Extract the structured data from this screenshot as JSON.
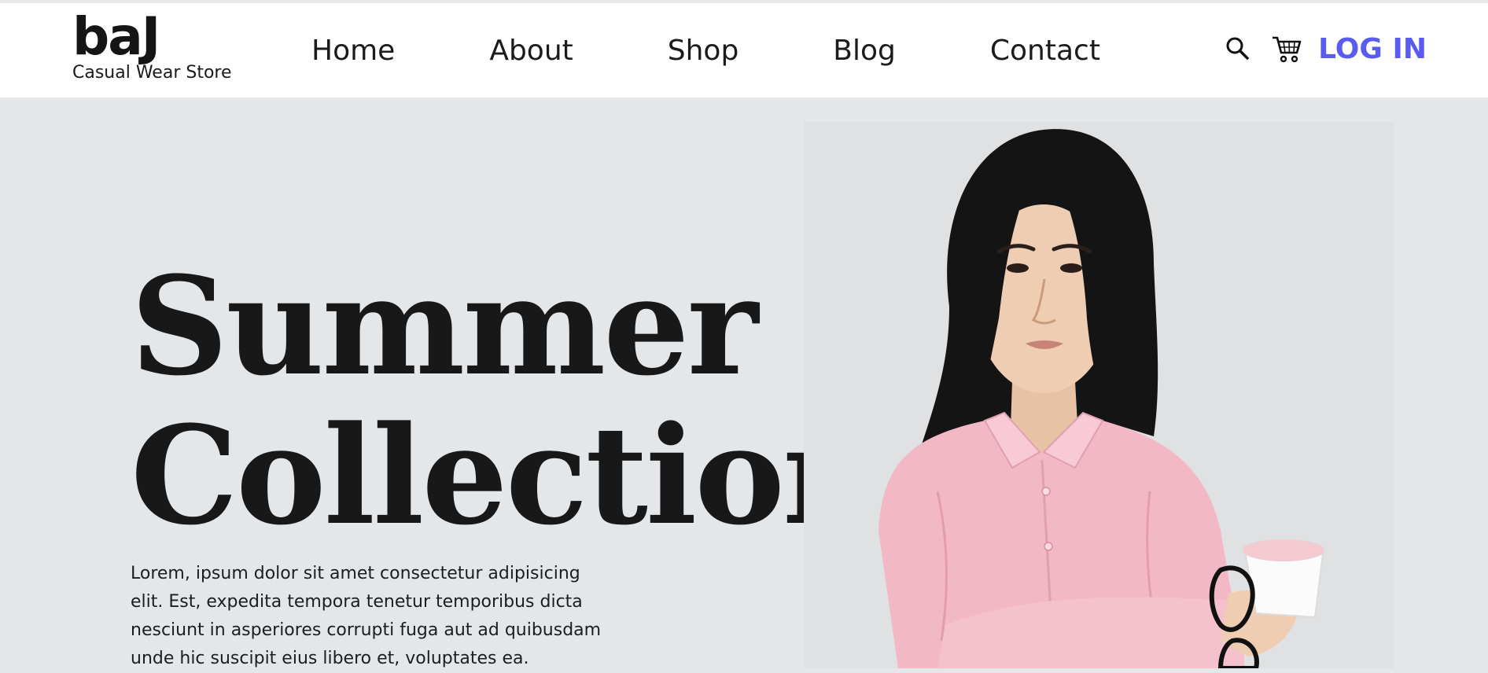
{
  "brand": {
    "name": "baJ",
    "tagline": "Casual Wear Store"
  },
  "nav": {
    "items": [
      {
        "label": "Home"
      },
      {
        "label": "About"
      },
      {
        "label": "Shop"
      },
      {
        "label": "Blog"
      },
      {
        "label": "Contact"
      }
    ]
  },
  "actions": {
    "search_icon": "search-icon",
    "cart_icon": "cart-icon",
    "login_label": "LOG IN"
  },
  "hero": {
    "title_line1": "Summer",
    "title_line2": "Collection",
    "text": "Lorem, ipsum dolor sit amet consectetur adipisicing elit. Est, expedita tempora tenetur temporibus dicta nesciunt in asperiores corrupti fuga aut ad quibusdam unde hic suscipit eius libero et, voluptates ea."
  },
  "colors": {
    "accent": "#5a5bef",
    "page_background": "#e4e7ea",
    "header_background": "#ffffff",
    "text": "#181818",
    "shirt": "#f2b8c6"
  }
}
